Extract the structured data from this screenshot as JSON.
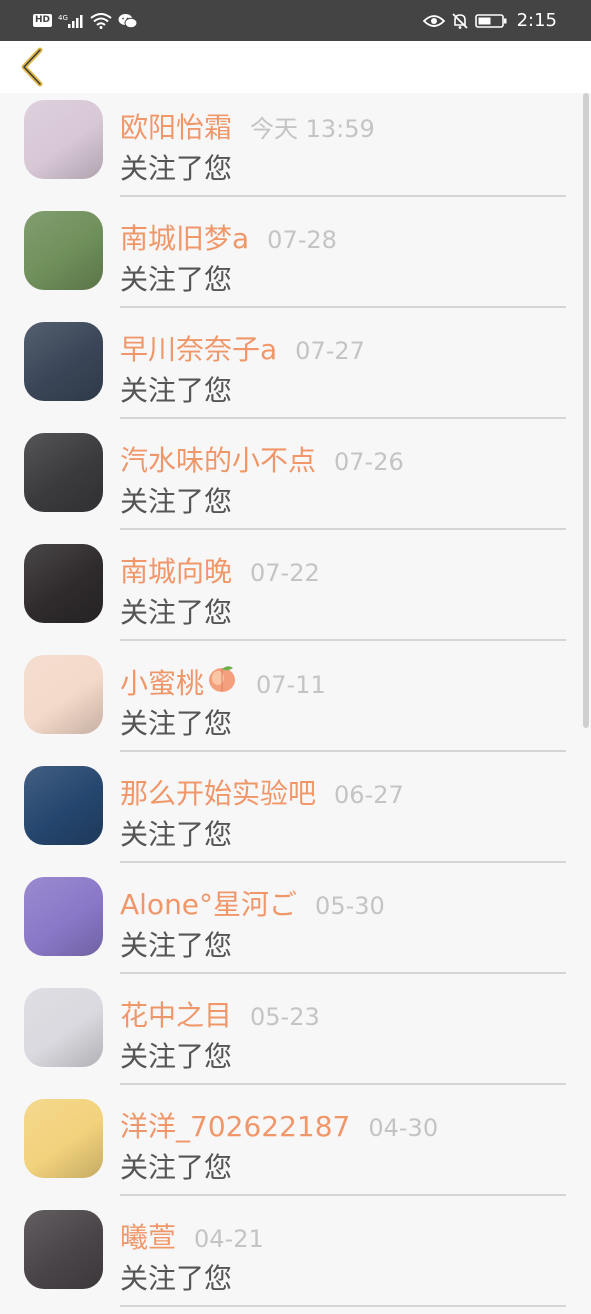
{
  "status_bar": {
    "hd_label": "HD",
    "network_label": "4G",
    "time": "2:15"
  },
  "colors": {
    "accent_name": "#f0976a",
    "back_arrow": "#e0b84a",
    "status_bar_bg": "#444444"
  },
  "notifications": [
    {
      "name": "欧阳怡霜",
      "time": "今天 13:59",
      "action": "关注了您",
      "avatar_color": "#d8c8d6"
    },
    {
      "name": "南城旧梦a",
      "time": "07-28",
      "action": "关注了您",
      "avatar_color": "#6f8f5a"
    },
    {
      "name": "早川奈奈子a",
      "time": "07-27",
      "action": "关注了您",
      "avatar_color": "#3a4658"
    },
    {
      "name": "汽水味的小不点",
      "time": "07-26",
      "action": "关注了您",
      "avatar_color": "#3b3b3e"
    },
    {
      "name": "南城向晚",
      "time": "07-22",
      "action": "关注了您",
      "avatar_color": "#2f2b2c"
    },
    {
      "name": "小蜜桃",
      "time": "07-11",
      "action": "关注了您",
      "avatar_color": "#f3d9c9"
    },
    {
      "name": "那么开始实验吧",
      "time": "06-27",
      "action": "关注了您",
      "avatar_color": "#25466e"
    },
    {
      "name": "Alone°星河ご",
      "time": "05-30",
      "action": "关注了您",
      "avatar_color": "#8a78c8"
    },
    {
      "name": "花中之目",
      "time": "05-23",
      "action": "关注了您",
      "avatar_color": "#d9d9df"
    },
    {
      "name": "洋洋_702622187",
      "time": "04-30",
      "action": "关注了您",
      "avatar_color": "#f2d27c"
    },
    {
      "name": "曦萱",
      "time": "04-21",
      "action": "关注了您",
      "avatar_color": "#4a4548"
    }
  ]
}
